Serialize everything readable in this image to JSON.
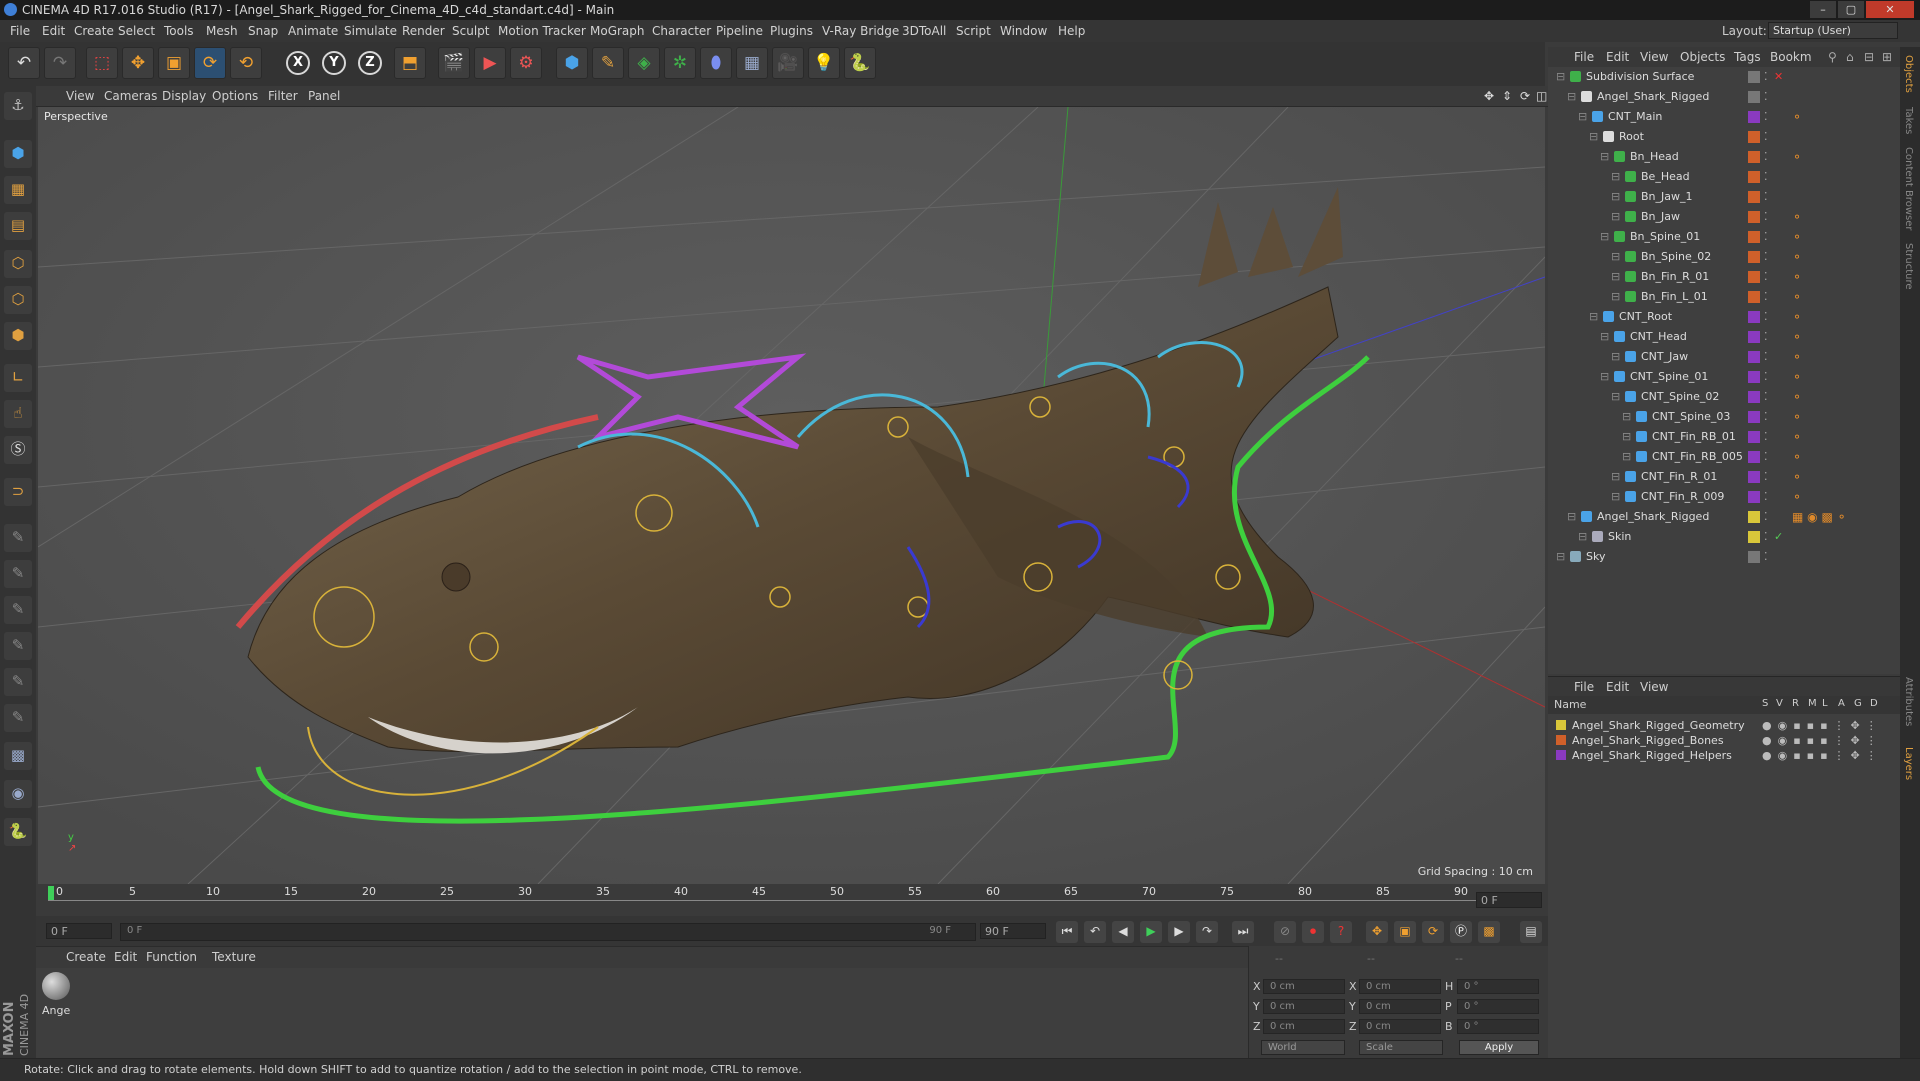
{
  "window": {
    "title": "CINEMA 4D R17.016 Studio (R17) - [Angel_Shark_Rigged_for_Cinema_4D_c4d_standart.c4d] - Main",
    "controls": [
      "–",
      "▢",
      "✕"
    ]
  },
  "menubar": {
    "items": [
      "File",
      "Edit",
      "Create",
      "Select",
      "Tools",
      "Mesh",
      "Snap",
      "Animate",
      "Simulate",
      "Render",
      "Sculpt",
      "Motion Tracker",
      "MoGraph",
      "Character",
      "Pipeline",
      "Plugins",
      "V-Ray Bridge",
      "3DToAll",
      "Script",
      "Window",
      "Help"
    ],
    "layout_label": "Layout:",
    "layout_value": "Startup (User)"
  },
  "toolbar": {
    "icons": [
      "undo-icon",
      "redo-icon",
      "live-selection-icon",
      "move-icon",
      "scale-icon",
      "rotate-icon",
      "recent-tool-icon",
      "x-axis-icon",
      "y-axis-icon",
      "z-axis-icon",
      "coordinate-system-icon",
      "render-view-icon",
      "render-picture-viewer-icon",
      "edit-render-settings-icon",
      "cube-icon",
      "pen-spline-icon",
      "subdivision-surface-icon",
      "cloner-icon",
      "deformer-icon",
      "floor-icon",
      "camera-icon",
      "light-icon",
      "python-icon"
    ],
    "axis_labels": [
      "X",
      "Y",
      "Z"
    ]
  },
  "viewport": {
    "menu": [
      "View",
      "Cameras",
      "Display",
      "Options",
      "Filter",
      "Panel"
    ],
    "label": "Perspective",
    "grid_spacing": "Grid Spacing : 10 cm"
  },
  "timeline": {
    "ticks": [
      "0",
      "5",
      "10",
      "15",
      "20",
      "25",
      "30",
      "35",
      "40",
      "45",
      "50",
      "55",
      "60",
      "65",
      "70",
      "75",
      "80",
      "85",
      "90"
    ],
    "frame_field": "0 F",
    "start_field": "0 F",
    "slider_start": "0 F",
    "slider_end": "90 F",
    "end_field": "90 F"
  },
  "material_manager": {
    "menu": [
      "Create",
      "Edit",
      "Function",
      "Texture"
    ],
    "material_name": "Ange"
  },
  "coordinates": {
    "header_a": "--",
    "header_b": "--",
    "header_c": "--",
    "rows": [
      {
        "l1": "X",
        "v1": "0 cm",
        "l2": "X",
        "v2": "0 cm",
        "l3": "H",
        "v3": "0 °"
      },
      {
        "l1": "Y",
        "v1": "0 cm",
        "l2": "Y",
        "v2": "0 cm",
        "l3": "P",
        "v3": "0 °"
      },
      {
        "l1": "Z",
        "v1": "0 cm",
        "l2": "Z",
        "v2": "0 cm",
        "l3": "B",
        "v3": "0 °"
      }
    ],
    "world": "World",
    "scale": "Scale",
    "apply": "Apply"
  },
  "status_bar": {
    "text": "Rotate: Click and drag to rotate elements. Hold down SHIFT to add to quantize rotation / add to the selection in point mode, CTRL to remove."
  },
  "object_manager": {
    "menu": [
      "File",
      "Edit",
      "View",
      "Objects",
      "Tags",
      "Bookm"
    ],
    "objects": [
      {
        "name": "Subdivision Surface",
        "indent": 0,
        "icon": "#3fb04a",
        "color": "#777777",
        "check": "✕",
        "check_color": "#e33",
        "tag": ""
      },
      {
        "name": "Angel_Shark_Rigged",
        "indent": 1,
        "icon": "#ddd",
        "color": "#777777",
        "check": "",
        "check_color": "#ccc",
        "tag": ""
      },
      {
        "name": "CNT_Main",
        "indent": 2,
        "icon": "#4aa3e8",
        "color": "#8a3ac0",
        "check": "",
        "check_color": "#ccc",
        "tag": "⚬"
      },
      {
        "name": "Root",
        "indent": 3,
        "icon": "#ddd",
        "color": "#d0602a",
        "check": "",
        "check_color": "#ccc",
        "tag": ""
      },
      {
        "name": "Bn_Head",
        "indent": 4,
        "icon": "#3fb04a",
        "color": "#d0602a",
        "check": "",
        "check_color": "#ccc",
        "tag": "⚬"
      },
      {
        "name": "Be_Head",
        "indent": 5,
        "icon": "#3fb04a",
        "color": "#d0602a",
        "check": "",
        "check_color": "#ccc",
        "tag": ""
      },
      {
        "name": "Bn_Jaw_1",
        "indent": 5,
        "icon": "#3fb04a",
        "color": "#d0602a",
        "check": "",
        "check_color": "#ccc",
        "tag": ""
      },
      {
        "name": "Bn_Jaw",
        "indent": 5,
        "icon": "#3fb04a",
        "color": "#d0602a",
        "check": "",
        "check_color": "#ccc",
        "tag": "⚬"
      },
      {
        "name": "Bn_Spine_01",
        "indent": 4,
        "icon": "#3fb04a",
        "color": "#d0602a",
        "check": "",
        "check_color": "#ccc",
        "tag": "⚬"
      },
      {
        "name": "Bn_Spine_02",
        "indent": 5,
        "icon": "#3fb04a",
        "color": "#d0602a",
        "check": "",
        "check_color": "#ccc",
        "tag": "⚬"
      },
      {
        "name": "Bn_Fin_R_01",
        "indent": 5,
        "icon": "#3fb04a",
        "color": "#d0602a",
        "check": "",
        "check_color": "#ccc",
        "tag": "⚬"
      },
      {
        "name": "Bn_Fin_L_01",
        "indent": 5,
        "icon": "#3fb04a",
        "color": "#d0602a",
        "check": "",
        "check_color": "#ccc",
        "tag": "⚬"
      },
      {
        "name": "CNT_Root",
        "indent": 3,
        "icon": "#4aa3e8",
        "color": "#8a3ac0",
        "check": "",
        "check_color": "#ccc",
        "tag": "⚬"
      },
      {
        "name": "CNT_Head",
        "indent": 4,
        "icon": "#4aa3e8",
        "color": "#8a3ac0",
        "check": "",
        "check_color": "#ccc",
        "tag": "⚬"
      },
      {
        "name": "CNT_Jaw",
        "indent": 5,
        "icon": "#4aa3e8",
        "color": "#8a3ac0",
        "check": "",
        "check_color": "#ccc",
        "tag": "⚬"
      },
      {
        "name": "CNT_Spine_01",
        "indent": 4,
        "icon": "#4aa3e8",
        "color": "#8a3ac0",
        "check": "",
        "check_color": "#ccc",
        "tag": "⚬"
      },
      {
        "name": "CNT_Spine_02",
        "indent": 5,
        "icon": "#4aa3e8",
        "color": "#8a3ac0",
        "check": "",
        "check_color": "#ccc",
        "tag": "⚬"
      },
      {
        "name": "CNT_Spine_03",
        "indent": 6,
        "icon": "#4aa3e8",
        "color": "#8a3ac0",
        "check": "",
        "check_color": "#ccc",
        "tag": "⚬"
      },
      {
        "name": "CNT_Fin_RB_01",
        "indent": 6,
        "icon": "#4aa3e8",
        "color": "#8a3ac0",
        "check": "",
        "check_color": "#ccc",
        "tag": "⚬"
      },
      {
        "name": "CNT_Fin_RB_005",
        "indent": 6,
        "icon": "#4aa3e8",
        "color": "#8a3ac0",
        "check": "",
        "check_color": "#ccc",
        "tag": "⚬"
      },
      {
        "name": "CNT_Fin_R_01",
        "indent": 5,
        "icon": "#4aa3e8",
        "color": "#8a3ac0",
        "check": "",
        "check_color": "#ccc",
        "tag": "⚬"
      },
      {
        "name": "CNT_Fin_R_009",
        "indent": 5,
        "icon": "#4aa3e8",
        "color": "#8a3ac0",
        "check": "",
        "check_color": "#ccc",
        "tag": "⚬"
      },
      {
        "name": "Angel_Shark_Rigged",
        "indent": 1,
        "icon": "#4aa3e8",
        "color": "#d9c73a",
        "check": "",
        "check_color": "#ccc",
        "tag": "▦ ◉ ▩ ⚬"
      },
      {
        "name": "Skin",
        "indent": 2,
        "icon": "#aab",
        "color": "#d9c73a",
        "check": "✓",
        "check_color": "#5c5",
        "tag": ""
      },
      {
        "name": "Sky",
        "indent": 0,
        "icon": "#8ab",
        "color": "#777777",
        "check": "",
        "check_color": "#ccc",
        "tag": ""
      }
    ]
  },
  "layer_manager": {
    "menu": [
      "File",
      "Edit",
      "View"
    ],
    "columns": [
      "Name",
      "S",
      "V",
      "R",
      "M",
      "L",
      "A",
      "G",
      "D"
    ],
    "layers": [
      {
        "name": "Angel_Shark_Rigged_Geometry",
        "color": "#d9c73a"
      },
      {
        "name": "Angel_Shark_Rigged_Bones",
        "color": "#d0602a"
      },
      {
        "name": "Angel_Shark_Rigged_Helpers",
        "color": "#8a3ac0"
      }
    ]
  },
  "side_tabs": [
    "Objects",
    "Takes",
    "Content Browser",
    "Structure",
    "Attributes",
    "Layers"
  ],
  "brand": {
    "maxon": "MAXON",
    "product": "CINEMA 4D"
  }
}
